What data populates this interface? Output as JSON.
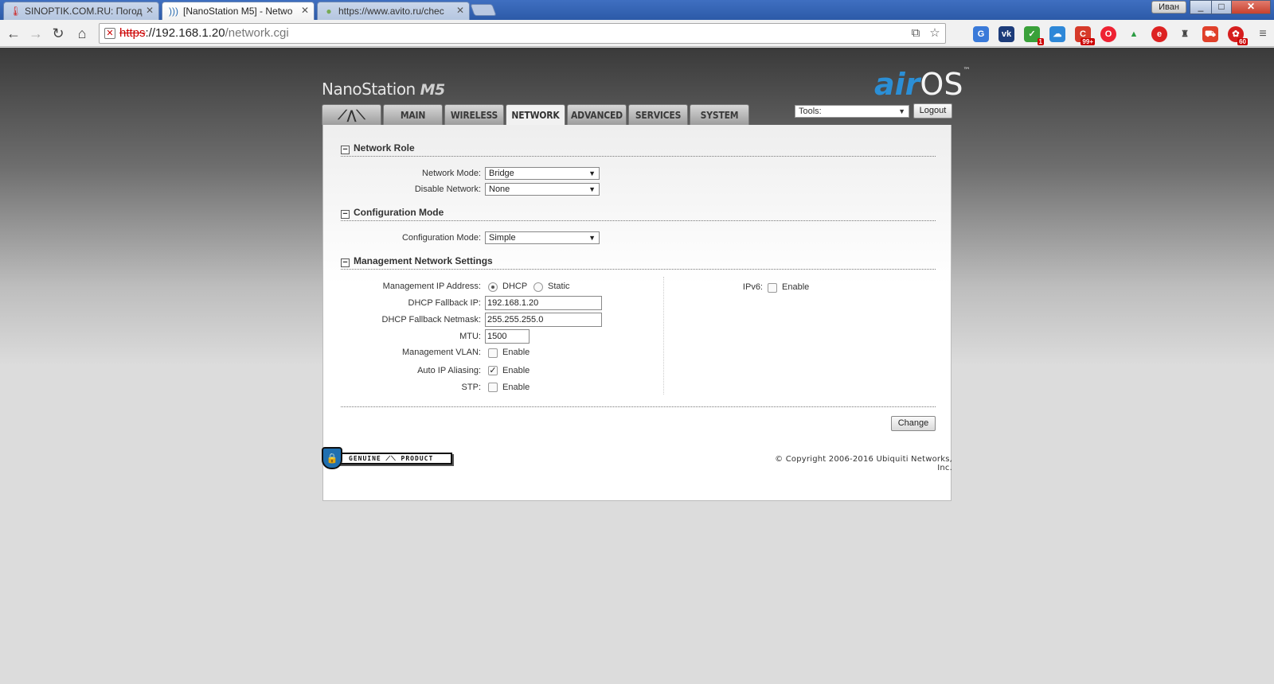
{
  "browser": {
    "tabs": [
      {
        "title": "SINOPTIK.COM.RU: Погод",
        "favicon": "thermometer-icon"
      },
      {
        "title": "[NanoStation M5] - Netwo",
        "favicon": "wifi-icon"
      },
      {
        "title": "https://www.avito.ru/chec",
        "favicon": "avito-icon"
      }
    ],
    "user": "Иван",
    "window_controls": {
      "minimize": "_",
      "maximize": "□",
      "close": "✕"
    },
    "url": {
      "scheme": "https",
      "host": "://192.168.1.20",
      "path": "/network.cgi"
    },
    "extension_badges": {
      "badge_1": "1",
      "badge_99": "99+",
      "badge_60": "60"
    }
  },
  "brand": {
    "product_name": "NanoStation",
    "product_model": "M5",
    "logo_air": "air",
    "logo_os": "OS",
    "logo_tm": "™"
  },
  "nav": {
    "tabs": [
      "MAIN",
      "WIRELESS",
      "NETWORK",
      "ADVANCED",
      "SERVICES",
      "SYSTEM"
    ],
    "active": "NETWORK"
  },
  "tools": {
    "label": "Tools:",
    "logout": "Logout"
  },
  "network_role": {
    "title": "Network Role",
    "network_mode_label": "Network Mode:",
    "network_mode_value": "Bridge",
    "disable_network_label": "Disable Network:",
    "disable_network_value": "None"
  },
  "configuration_mode": {
    "title": "Configuration Mode",
    "label": "Configuration Mode:",
    "value": "Simple"
  },
  "management": {
    "title": "Management Network Settings",
    "ip_address_label": "Management IP Address:",
    "dhcp_label": "DHCP",
    "static_label": "Static",
    "fallback_ip_label": "DHCP Fallback IP:",
    "fallback_ip_value": "192.168.1.20",
    "fallback_netmask_label": "DHCP Fallback Netmask:",
    "fallback_netmask_value": "255.255.255.0",
    "mtu_label": "MTU:",
    "mtu_value": "1500",
    "vlan_label": "Management VLAN:",
    "auto_ip_label": "Auto IP Aliasing:",
    "stp_label": "STP:",
    "enable_label": "Enable",
    "ipv6_label": "IPv6:"
  },
  "actions": {
    "change": "Change"
  },
  "footer": {
    "genuine": "GENUINE ⟋⟍ PRODUCT",
    "copyright": "© Copyright 2006-2016 Ubiquiti Networks, Inc."
  },
  "colors": {
    "accent": "#2b8fd6",
    "page_bg": "#dcdcdc",
    "header_dark": "#3a3a3a"
  }
}
